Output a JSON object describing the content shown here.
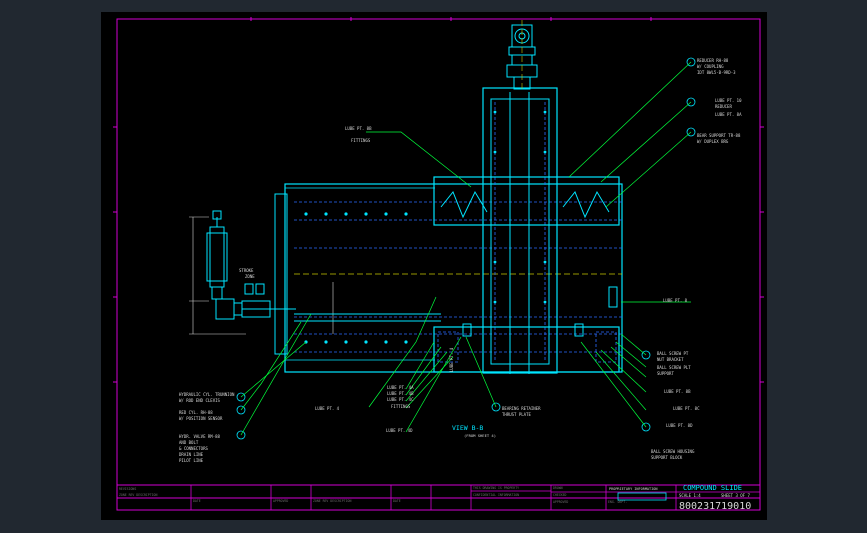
{
  "colors": {
    "background": "#000000",
    "frame": "#d200d2",
    "part": "#00e5ff",
    "hidden": "#2c6cff",
    "leader": "#00ff3c",
    "text": "#d8d8d8",
    "window": "#212830"
  },
  "section_title": "VIEW B-B",
  "section_sub": "(FROM SHEET 4)",
  "labels": {
    "l1": "LUBE PT. 8B",
    "l1b": "FITTINGS",
    "r1a": "REDUCER RH-88",
    "r1b": "W/ COUPLING",
    "r1c": "IDT 8WL5-B-9RD-3",
    "r2a": "LUBE PT. 10",
    "r2b": "REDUCER",
    "r3": "LUBE PT. 8A",
    "r4a": "BEAR SUPPORT TR-88",
    "r4b": "W/ DUPLEX BRG",
    "r5": "LUBE PT. 8",
    "r6a": "BALL SCREW PT",
    "r6b": "NUT BRACKET",
    "r7a": "BALL SCREW PLT",
    "r7b": "SUPPORT",
    "r8": "LUBE PT. 8B",
    "r9": "LUBE PT. 8C",
    "r10": "LUBE PT. 8D",
    "r11a": "BALL SCREW HOUSING",
    "r11b": "SUPPORT BLOCK",
    "bl1a": "HYDRAULIC CYL. TRUNNION",
    "bl1b": "W/ ROD END CLEVIS",
    "bl2a": "RED CYL. RH-88",
    "bl2b": "W/ POSITION SENSOR",
    "bl3a": "HYDR. VALVE RM-88",
    "bl3b": "AND BOLT",
    "bl3c": "& CONNECTORS",
    "bl3d": "DRAIN LINE",
    "bl3e": "PILOT LINE",
    "c1": "LUBE PT. 4",
    "c2": "LUBE PT. 4A",
    "c3": "LUBE PT. 4B",
    "c4": "LUBE PT. 4C",
    "c5": "FITTINGS",
    "c6": "LUBE PT. 4D",
    "c7": "LUBE PT. 4",
    "c8a": "BEARING RETAINER",
    "c8b": "THRUST PLATE",
    "dim1": "STROKE",
    "dim2": "ZONE"
  },
  "title_block": {
    "title": "COMPOUND SLIDE",
    "number": "800231719010",
    "sheet": "SHEET 3 OF 7",
    "scale": "SCALE 1:4",
    "sub": "PROPRIETARY INFORMATION"
  }
}
